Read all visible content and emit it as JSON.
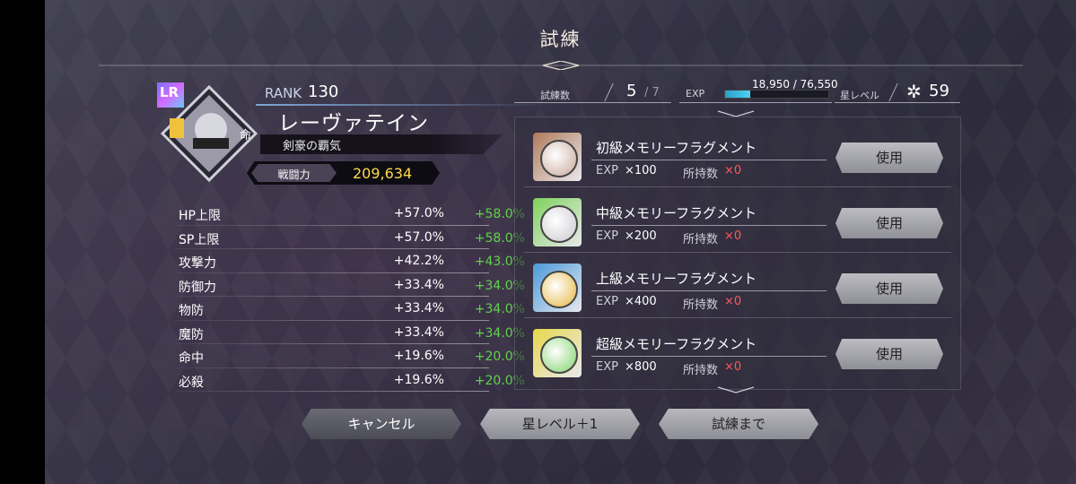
{
  "header": {
    "title": "試練"
  },
  "character": {
    "rarity": "LR",
    "element": "命",
    "rank_label": "RANK",
    "rank_value": "130",
    "name": "レーヴァテイン",
    "epithet": "剣豪の覇気",
    "power_label": "戦闘力",
    "power_value": "209,634"
  },
  "stats": [
    {
      "name": "HP上限",
      "current": "+57.0%",
      "next": "+58.0%"
    },
    {
      "name": "SP上限",
      "current": "+57.0%",
      "next": "+58.0%"
    },
    {
      "name": "攻撃力",
      "current": "+42.2%",
      "next": "+43.0%"
    },
    {
      "name": "防御力",
      "current": "+33.4%",
      "next": "+34.0%"
    },
    {
      "name": "物防",
      "current": "+33.4%",
      "next": "+34.0%"
    },
    {
      "name": "魔防",
      "current": "+33.4%",
      "next": "+34.0%"
    },
    {
      "name": "命中",
      "current": "+19.6%",
      "next": "+20.0%"
    },
    {
      "name": "必殺",
      "current": "+19.6%",
      "next": "+20.0%"
    }
  ],
  "progress": {
    "trial_label": "試練数",
    "trial_count": "5",
    "trial_max": "/ 7",
    "exp_label": "EXP",
    "exp_text": "18,950 / 76,550",
    "exp_fraction": 0.2475,
    "star_label": "星レベル",
    "star_icon": "star-icon",
    "star_value": "59"
  },
  "items": [
    {
      "name": "初級メモリーフラグメント",
      "exp_label": "EXP",
      "exp": "×100",
      "owned_label": "所持数",
      "owned": "×0",
      "button": "使用",
      "frame": "#b07a5a",
      "coin": "#c7a79b"
    },
    {
      "name": "中級メモリーフラグメント",
      "exp_label": "EXP",
      "exp": "×200",
      "owned_label": "所持数",
      "owned": "×0",
      "button": "使用",
      "frame": "#7fd25a",
      "coin": "#c9c9cf"
    },
    {
      "name": "上級メモリーフラグメント",
      "exp_label": "EXP",
      "exp": "×400",
      "owned_label": "所持数",
      "owned": "×0",
      "button": "使用",
      "frame": "#4a9ad8",
      "coin": "#e6b640"
    },
    {
      "name": "超級メモリーフラグメント",
      "exp_label": "EXP",
      "exp": "×800",
      "owned_label": "所持数",
      "owned": "×0",
      "button": "使用",
      "frame": "#e8d84a",
      "coin": "#7fd26a"
    }
  ],
  "buttons": {
    "cancel": "キャンセル",
    "star_up": "星レベル＋1",
    "to_trial": "試練まで"
  }
}
